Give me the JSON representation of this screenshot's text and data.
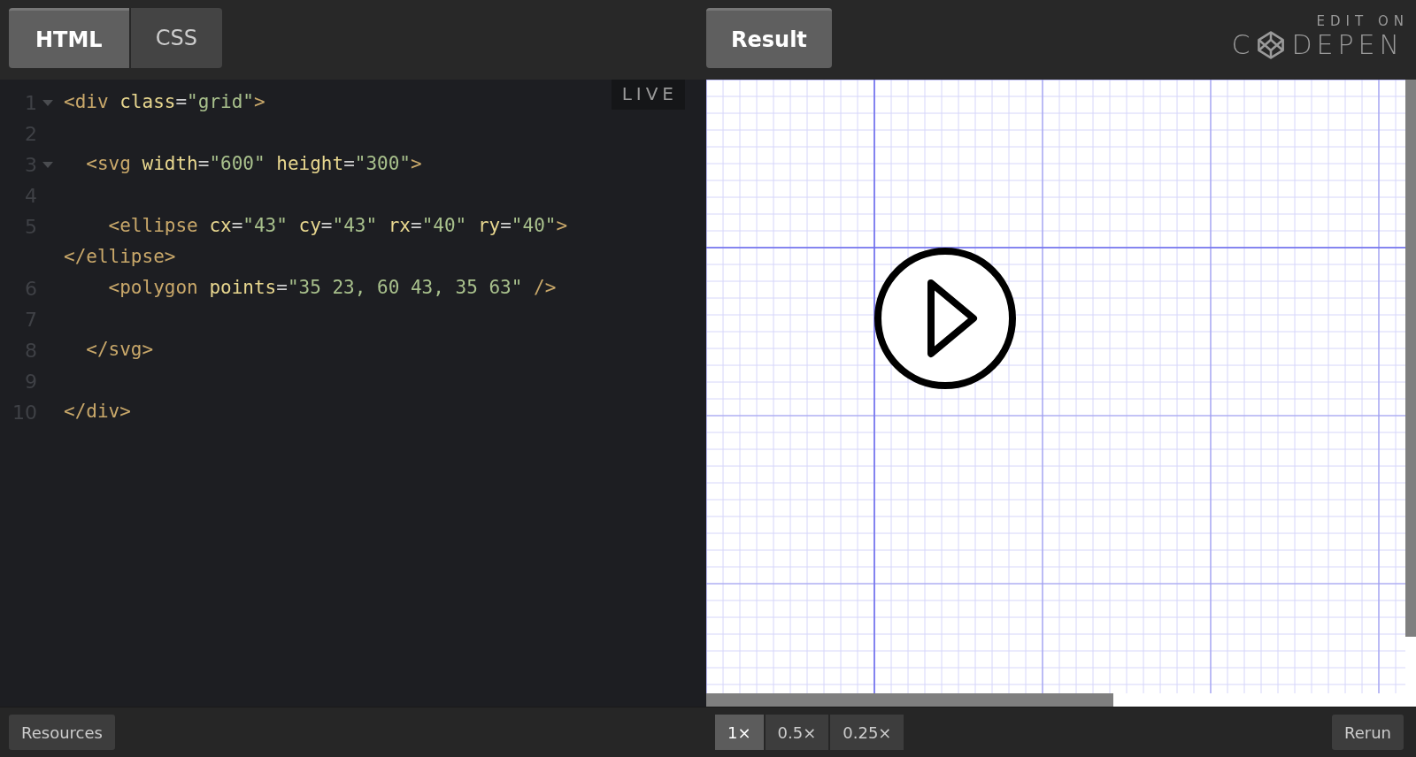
{
  "editor_tabs": [
    {
      "label": "HTML",
      "selected": true
    },
    {
      "label": "CSS",
      "selected": false
    }
  ],
  "live_badge": "LIVE",
  "code_lines": [
    {
      "number": "1",
      "foldable": true,
      "tokens": [
        {
          "kind": "tag",
          "text": "<div"
        },
        {
          "kind": "attr",
          "text": " class"
        },
        {
          "kind": "plain",
          "text": "="
        },
        {
          "kind": "str",
          "text": "\"grid\""
        },
        {
          "kind": "tag",
          "text": ">"
        }
      ]
    },
    {
      "number": "2",
      "foldable": false
    },
    {
      "number": "3",
      "foldable": true,
      "tokens": [
        {
          "kind": "tag",
          "text": "  <svg"
        },
        {
          "kind": "attr",
          "text": " width"
        },
        {
          "kind": "plain",
          "text": "="
        },
        {
          "kind": "str",
          "text": "\"600\""
        },
        {
          "kind": "attr",
          "text": " height"
        },
        {
          "kind": "plain",
          "text": "="
        },
        {
          "kind": "str",
          "text": "\"300\""
        },
        {
          "kind": "tag",
          "text": ">"
        }
      ]
    },
    {
      "number": "4",
      "foldable": false
    },
    {
      "number": "5",
      "foldable": false,
      "tokens": [
        {
          "kind": "tag",
          "text": "    <ellipse"
        },
        {
          "kind": "attr",
          "text": " cx"
        },
        {
          "kind": "plain",
          "text": "="
        },
        {
          "kind": "str",
          "text": "\"43\""
        },
        {
          "kind": "attr",
          "text": " cy"
        },
        {
          "kind": "plain",
          "text": "="
        },
        {
          "kind": "str",
          "text": "\"43\""
        },
        {
          "kind": "attr",
          "text": " rx"
        },
        {
          "kind": "plain",
          "text": "="
        },
        {
          "kind": "str",
          "text": "\"40\""
        },
        {
          "kind": "attr",
          "text": " ry"
        },
        {
          "kind": "plain",
          "text": "="
        },
        {
          "kind": "str",
          "text": "\"40\""
        },
        {
          "kind": "tag",
          "text": ">"
        },
        {
          "kind": "tag",
          "text": " </ellipse>"
        }
      ]
    },
    {
      "number": "6",
      "foldable": false,
      "tokens": [
        {
          "kind": "tag",
          "text": "    <polygon"
        },
        {
          "kind": "attr",
          "text": " points"
        },
        {
          "kind": "plain",
          "text": "="
        },
        {
          "kind": "str",
          "text": "\"35 23, 60 43, 35 63\""
        },
        {
          "kind": "tag",
          "text": " />"
        }
      ]
    },
    {
      "number": "7",
      "foldable": false
    },
    {
      "number": "8",
      "foldable": false,
      "tokens": [
        {
          "kind": "tag",
          "text": "  </svg>"
        }
      ]
    },
    {
      "number": "9",
      "foldable": false
    },
    {
      "number": "10",
      "foldable": false,
      "tokens": [
        {
          "kind": "tag",
          "text": "</div>"
        }
      ]
    }
  ],
  "result_tab": {
    "label": "Result",
    "selected": true
  },
  "logo": {
    "caption": "EDIT ON",
    "before": "C",
    "after": "DEPEN"
  },
  "resources_button": "Resources",
  "zoom_buttons": [
    {
      "label": "1×",
      "selected": true
    },
    {
      "label": "0.5×",
      "selected": false
    },
    {
      "label": "0.25×",
      "selected": false
    }
  ],
  "rerun_button": "Rerun"
}
